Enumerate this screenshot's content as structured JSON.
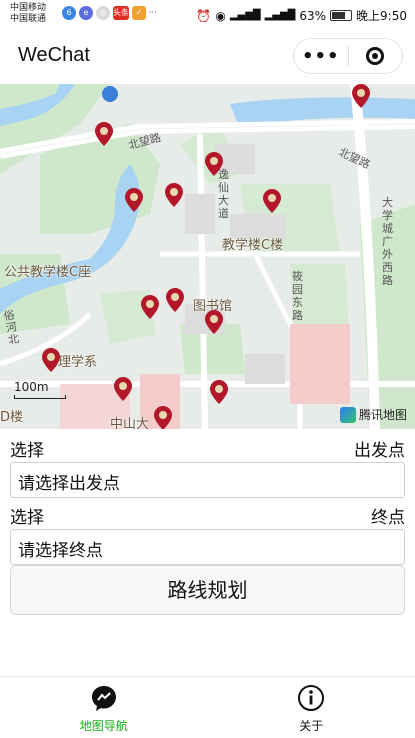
{
  "status_bar": {
    "carrier_1": "中国移动",
    "carrier_2": "中国联通",
    "dots": "···",
    "battery": "63%",
    "time": "晚上9:50",
    "app_badge": "头条"
  },
  "navbar": {
    "title": "WeChat",
    "more_label": "•••"
  },
  "map": {
    "labels": {
      "public_building": "公共教学楼C座",
      "teaching_c": "教学楼C楼",
      "library": "图书馆",
      "physics": "物理学系",
      "zhongshan": "中山大",
      "d_building": "D楼"
    },
    "roads": {
      "beiwang": "北望路",
      "beiwang2": "北望路",
      "yixian": "逸仙大道",
      "yuanxi": "筱园东路",
      "gucheng": "大学城广外西路",
      "left_road": "俗河北"
    },
    "scale": "100m",
    "provider": "腾讯地图",
    "pin_color": "#b3172a"
  },
  "form": {
    "start_label_left": "选择",
    "start_label_right": "出发点",
    "start_value": "请选择出发点",
    "end_label_left": "选择",
    "end_label_right": "终点",
    "end_value": "请选择终点",
    "plan_button": "路线规划"
  },
  "tabbar": {
    "nav_label": "地图导航",
    "about_label": "关于",
    "active_color": "#1aad19"
  }
}
